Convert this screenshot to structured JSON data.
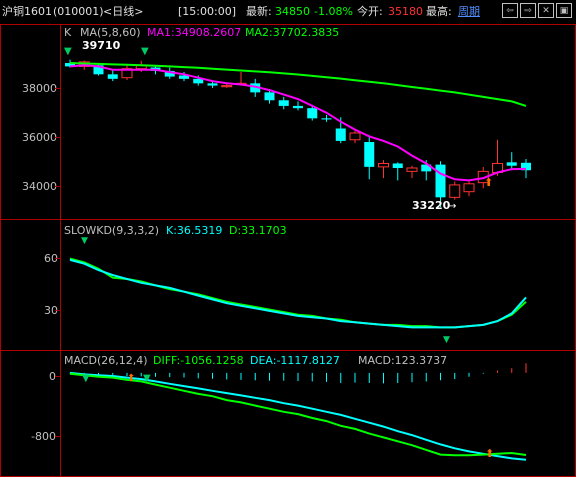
{
  "header": {
    "symbol": "沪铜1601",
    "code": "(010001)",
    "period": "<日线>",
    "time": "[15:00:00]",
    "latest_label": "最新:",
    "latest_value": "34850",
    "change_pct": "-1.08%",
    "open_label": "今开:",
    "open_value": "35180",
    "high_label": "最高:",
    "period_link": "周期",
    "buttons": [
      "⇦",
      "⇨",
      "✕",
      "▣"
    ]
  },
  "colors": {
    "up": "#ff3232",
    "down": "#00ffff",
    "ma1": "#ff00ff",
    "ma2": "#00ff00",
    "kline": "#00ffff",
    "dline": "#00ff00",
    "border": "#b00000",
    "axis_text": "#c0c0c0"
  },
  "main": {
    "indicator": "K",
    "ma_label": "MA(5,8,60)",
    "ma1_label": "MA1:34908.2607",
    "ma2_label": "MA2:37702.3835",
    "max_label": "39710",
    "min_label": "33220",
    "y_ticks": [
      "38000",
      "36000",
      "34000"
    ]
  },
  "kd": {
    "label": "SLOWKD(9,3,3,2)",
    "k_label": "K:36.5319",
    "d_label": "D:33.1703",
    "y_ticks": [
      "60",
      "30"
    ]
  },
  "macd": {
    "label": "MACD(26,12,4)",
    "diff_label": "DIFF:-1056.1258",
    "dea_label": "DEA:-1117.8127",
    "macd_label": "MACD:123.3737",
    "y_ticks": [
      "0",
      "-800"
    ]
  },
  "chart_data": {
    "type": "line",
    "candles": [
      [
        39600,
        39750,
        39400,
        39450
      ],
      [
        39450,
        39710,
        39300,
        39650
      ],
      [
        39500,
        39600,
        39050,
        39100
      ],
      [
        39100,
        39300,
        38800,
        38900
      ],
      [
        38950,
        39500,
        38850,
        39350
      ],
      [
        39350,
        39700,
        39200,
        39500
      ],
      [
        39400,
        39500,
        39100,
        39250
      ],
      [
        39250,
        39400,
        38900,
        39000
      ],
      [
        39050,
        39200,
        38800,
        38900
      ],
      [
        38900,
        39050,
        38600,
        38700
      ],
      [
        38700,
        38800,
        38500,
        38600
      ],
      [
        38550,
        38700,
        38500,
        38600
      ],
      [
        38650,
        39200,
        38600,
        38700
      ],
      [
        38700,
        38900,
        38100,
        38300
      ],
      [
        38300,
        38450,
        37800,
        37950
      ],
      [
        37950,
        38100,
        37550,
        37700
      ],
      [
        37700,
        37900,
        37500,
        37600
      ],
      [
        37600,
        37750,
        37050,
        37150
      ],
      [
        37150,
        37300,
        37000,
        37100
      ],
      [
        36700,
        37200,
        36050,
        36150
      ],
      [
        36200,
        36600,
        36050,
        36500
      ],
      [
        36100,
        36400,
        34450,
        35000
      ],
      [
        35000,
        35300,
        34500,
        35150
      ],
      [
        35150,
        35200,
        34400,
        34950
      ],
      [
        34800,
        35050,
        34500,
        34950
      ],
      [
        35100,
        35300,
        34400,
        34800
      ],
      [
        35100,
        35250,
        33220,
        33650
      ],
      [
        33650,
        34350,
        33550,
        34200
      ],
      [
        33900,
        34350,
        33700,
        34250
      ],
      [
        34300,
        35000,
        34050,
        34800
      ],
      [
        34750,
        36200,
        34600,
        35150
      ],
      [
        35200,
        35650,
        34850,
        35050
      ],
      [
        35180,
        35350,
        34500,
        34850
      ]
    ],
    "ma5": [
      39450,
      39500,
      39450,
      39300,
      39300,
      39300,
      39300,
      39200,
      39100,
      38950,
      38800,
      38700,
      38650,
      38550,
      38400,
      38200,
      38000,
      37700,
      37400,
      37000,
      36650,
      36350,
      36150,
      35900,
      35500,
      35150,
      34700,
      34450,
      34400,
      34500,
      34750,
      34900,
      34908
    ],
    "ma60": [
      39600,
      39580,
      39560,
      39540,
      39520,
      39500,
      39480,
      39450,
      39420,
      39390,
      39350,
      39310,
      39270,
      39230,
      39190,
      39140,
      39090,
      39030,
      38970,
      38910,
      38840,
      38770,
      38700,
      38620,
      38540,
      38460,
      38380,
      38300,
      38200,
      38100,
      38000,
      37900,
      37702
    ],
    "kd_k": [
      66,
      63,
      58,
      54,
      51,
      48,
      46,
      44,
      41,
      38,
      35,
      32,
      30,
      28,
      26,
      24,
      22,
      21,
      20,
      18,
      17,
      16,
      15,
      14,
      13,
      13,
      13,
      13,
      14,
      15,
      18,
      24,
      36.53
    ],
    "kd_d": [
      67,
      64,
      59,
      52,
      51,
      49,
      46,
      43,
      41,
      39,
      36,
      33,
      31,
      29,
      27,
      25,
      23,
      22,
      20,
      19,
      17,
      16,
      15,
      15,
      14,
      14,
      13,
      13,
      14,
      15,
      18,
      23,
      33.17
    ],
    "macd_diff": [
      -10,
      -30,
      -50,
      -60,
      -90,
      -110,
      -150,
      -190,
      -230,
      -270,
      -300,
      -350,
      -380,
      -420,
      -460,
      -500,
      -530,
      -580,
      -620,
      -680,
      -720,
      -780,
      -830,
      -880,
      -930,
      -990,
      -1050,
      -1060,
      -1060,
      -1050,
      -1040,
      -1030,
      -1056.13
    ],
    "macd_dea": [
      0,
      -20,
      -30,
      -40,
      -60,
      -80,
      -110,
      -140,
      -170,
      -200,
      -230,
      -260,
      -290,
      -320,
      -350,
      -390,
      -420,
      -460,
      -500,
      -540,
      -590,
      -640,
      -690,
      -750,
      -800,
      -860,
      -920,
      -970,
      -1010,
      -1040,
      -1070,
      -1100,
      -1117.81
    ],
    "macd_hist": [
      -10,
      -20,
      -30,
      -25,
      -40,
      -45,
      -50,
      -55,
      -60,
      -70,
      -75,
      -85,
      -90,
      -95,
      -100,
      -100,
      -105,
      -110,
      -115,
      -130,
      -125,
      -130,
      -135,
      -130,
      -120,
      -110,
      -95,
      -80,
      -50,
      -10,
      30,
      60,
      123.37
    ],
    "main_ylim": [
      33000,
      40000
    ],
    "kd_ylim": [
      0,
      80
    ],
    "macd_ylim": [
      -1300,
      50
    ]
  }
}
